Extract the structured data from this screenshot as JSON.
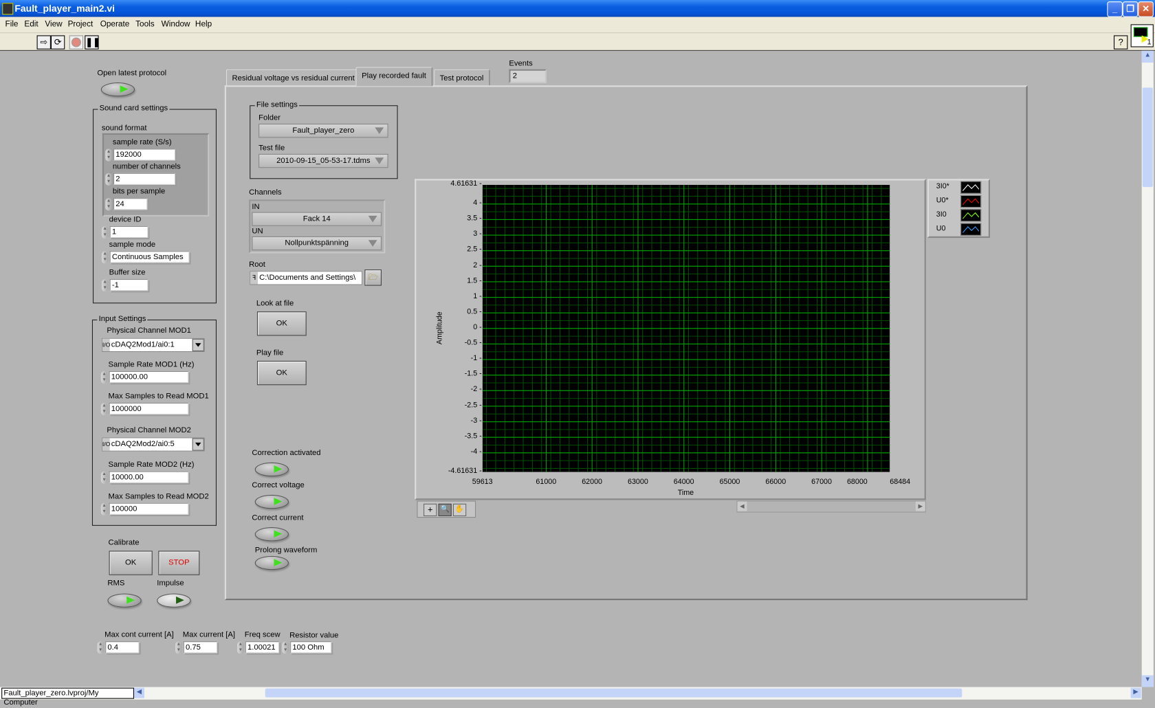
{
  "window": {
    "title": "Fault_player_main2.vi"
  },
  "menu": [
    "File",
    "Edit",
    "View",
    "Project",
    "Operate",
    "Tools",
    "Window",
    "Help"
  ],
  "toolbar": {
    "run": "run-arrow",
    "run_cont": "run-continuously",
    "abort": "abort",
    "pause": "pause",
    "help": "?",
    "vi_icon_number": "1"
  },
  "left": {
    "open_latest_protocol": "Open latest protocol",
    "sound_card": {
      "title": "Sound card settings",
      "sound_format": "sound format",
      "sample_rate_label": "sample rate (S/s)",
      "sample_rate": "192000",
      "channels_label": "number of channels",
      "channels": "2",
      "bits_label": "bits per sample",
      "bits": "24",
      "device_label": "device ID",
      "device": "1",
      "mode_label": "sample mode",
      "mode": "Continuous Samples",
      "buffer_label": "Buffer size",
      "buffer": "-1"
    },
    "input": {
      "title": "Input Settings",
      "pc1_label": "Physical Channel MOD1",
      "pc1": "cDAQ2Mod1/ai0:1",
      "sr1_label": "Sample Rate MOD1 (Hz)",
      "sr1": "100000.00",
      "ms1_label": "Max Samples to Read MOD1",
      "ms1": "1000000",
      "pc2_label": "Physical Channel MOD2",
      "pc2": "cDAQ2Mod2/ai0:5",
      "sr2_label": "Sample Rate MOD2 (Hz)",
      "sr2": "10000.00",
      "ms2_label": "Max Samples to Read MOD2",
      "ms2": "100000"
    },
    "calibrate": {
      "label": "Calibrate",
      "ok": "OK",
      "stop": "STOP",
      "rms": "RMS",
      "impulse": "Impulse"
    },
    "bottom": {
      "maxcont_label": "Max cont current [A]",
      "maxcont": "0.4",
      "maxcur_label": "Max current [A]",
      "maxcur": "0.75",
      "freq_label": "Freq scew",
      "freq": "1.00021",
      "res_label": "Resistor value",
      "res": "100 Ohm"
    }
  },
  "tabs": [
    {
      "label": "Residual voltage vs residual current"
    },
    {
      "label": "Play recorded fault",
      "selected": true
    },
    {
      "label": "Test protocol"
    }
  ],
  "events": {
    "label": "Events",
    "value": "2"
  },
  "play": {
    "file_settings": "File settings",
    "folder_label": "Folder",
    "folder": "Fault_player_zero",
    "testfile_label": "Test file",
    "testfile": "2010-09-15_05-53-17.tdms",
    "channels_label": "Channels",
    "in_label": "IN",
    "in": "Fack 14",
    "un_label": "UN",
    "un": "Nollpunktspänning",
    "root_label": "Root",
    "root": "C:\\Documents and Settings\\",
    "look_label": "Look at file",
    "look_ok": "OK",
    "play_label": "Play file",
    "play_ok": "OK",
    "correction": "Correction activated",
    "correct_voltage": "Correct voltage",
    "correct_current": "Correct current",
    "prolong": "Prolong waveform"
  },
  "status": {
    "path": "Fault_player_zero.lvproj/My Computer"
  },
  "chart_data": {
    "type": "line",
    "xlabel": "Time",
    "ylabel": "Amplitude",
    "xlim": [
      59613,
      68484
    ],
    "ylim": [
      -4.61631,
      4.61631
    ],
    "x_ticks": [
      "59613",
      "61000",
      "62000",
      "63000",
      "64000",
      "65000",
      "66000",
      "67000",
      "68000",
      "68484"
    ],
    "y_ticks": [
      "4.61631",
      "4",
      "3.5",
      "3",
      "2.5",
      "2",
      "1.5",
      "1",
      "0.5",
      "0",
      "-0.5",
      "-1",
      "-1.5",
      "-2",
      "-2.5",
      "-3",
      "-3.5",
      "-4",
      "-4.61631"
    ],
    "grid": true,
    "background": "#000000",
    "grid_color": "#00a000",
    "legend_position": "right",
    "series": [
      {
        "name": "3I0*",
        "color": "#ffffff",
        "values": []
      },
      {
        "name": "U0*",
        "color": "#ff0000",
        "values": []
      },
      {
        "name": "3I0",
        "color": "#80ff00",
        "values": []
      },
      {
        "name": "U0",
        "color": "#3399ff",
        "values": []
      }
    ]
  }
}
